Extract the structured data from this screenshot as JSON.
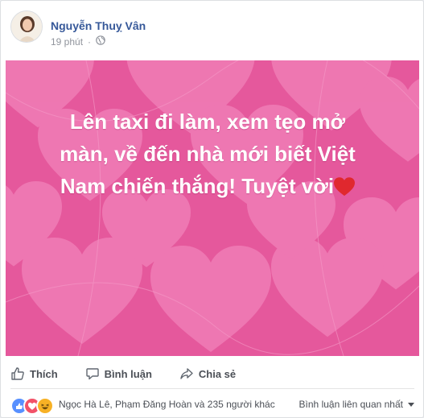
{
  "post": {
    "author": "Nguyễn Thuỵ Vân",
    "time": "19 phút",
    "separator": "·",
    "text_lines": [
      "Lên taxi đi làm, xem tẹo mở",
      "màn, về đến nhà mới biết Việt",
      "Nam chiến thắng! Tuyệt vời"
    ],
    "background_color": "#e5579b"
  },
  "actions": {
    "like": "Thích",
    "comment": "Bình luận",
    "share": "Chia sẻ"
  },
  "reactions": {
    "summary": "Ngọc Hà Lê, Phạm Đăng Hoàn và 235 người khác",
    "sort_label": "Bình luận liên quan nhất"
  },
  "colors": {
    "link": "#365899",
    "like_blue": "#5890ff",
    "love_red": "#f25268",
    "haha_yellow": "#f7b125"
  }
}
